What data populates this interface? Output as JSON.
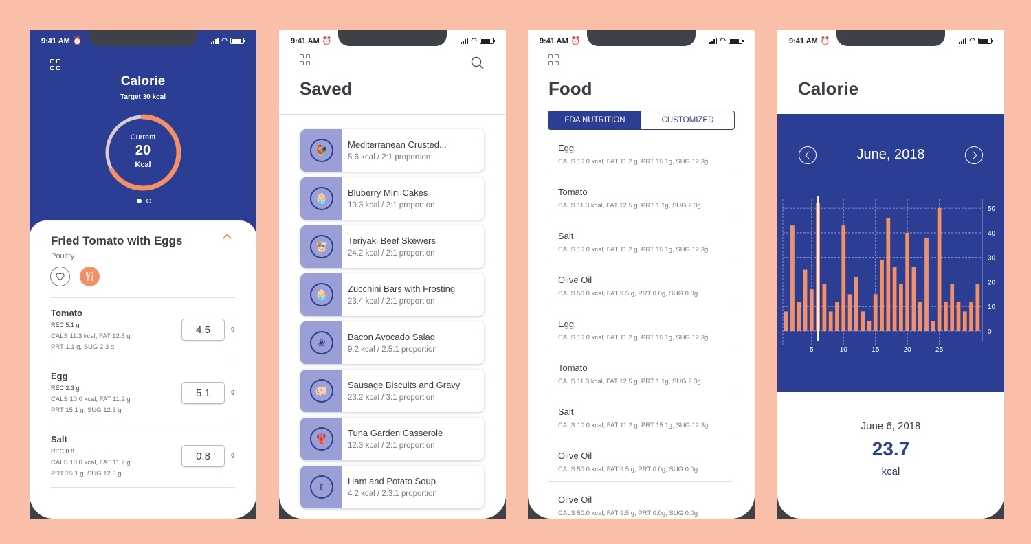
{
  "status": {
    "time": "9:41 AM"
  },
  "colors": {
    "brand": "#2c3e94",
    "accent": "#f39066",
    "background": "#f9bfa8",
    "thumb": "#9aa0d6"
  },
  "calorie_screen": {
    "title": "Calorie",
    "target": "Target 30 kcal",
    "gauge": {
      "label": "Current",
      "value": "20",
      "unit": "Kcal",
      "progress": 0.667
    },
    "recipe": {
      "title": "Fried Tomato with Eggs",
      "category": "Poultry",
      "ingredients": [
        {
          "name": "Tomato",
          "rec": "REC  5.1 g",
          "line1": "CALS 11.3 kcal, FAT 12.5 g",
          "line2": "PRT 1.1 g, SUG 2.3 g",
          "qty": "4.5",
          "unit": "g"
        },
        {
          "name": "Egg",
          "rec": "REC 2.3 g",
          "line1": "CALS 10.0 kcal, FAT 11.2 g",
          "line2": "PRT 15.1 g, SUG 12.3 g",
          "qty": "5.1",
          "unit": "g"
        },
        {
          "name": "Salt",
          "rec": "REC 0.8",
          "line1": "CALS 10.0 kcal, FAT 11.2 g",
          "line2": "PRT 15.1 g, SUG 12.3 g",
          "qty": "0.8",
          "unit": "g"
        }
      ]
    }
  },
  "saved_screen": {
    "title": "Saved",
    "items": [
      {
        "title": "Mediterranean Crusted...",
        "sub": "5.6 kcal / 2:1 proportion",
        "icon": "chicken-icon",
        "glyph": "🐓"
      },
      {
        "title": "Bluberry Mini Cakes",
        "sub": "10.3 kcal / 2:1 proportion",
        "icon": "cupcake-icon",
        "glyph": "🧁"
      },
      {
        "title": "Teriyaki Beef Skewers",
        "sub": "24.2 kcal / 2:1 proportion",
        "icon": "cow-icon",
        "glyph": "🐮"
      },
      {
        "title": "Zucchini Bars with Frosting",
        "sub": "23.4 kcal / 2:1 proportion",
        "icon": "cupcake-icon",
        "glyph": "🧁"
      },
      {
        "title": "Bacon Avocado Salad",
        "sub": "9.2 kcal / 2.5:1 proportion",
        "icon": "salad-icon",
        "glyph": "❀"
      },
      {
        "title": "Sausage Biscuits and Gravy",
        "sub": "23.2 kcal / 3:1 proportion",
        "icon": "pig-icon",
        "glyph": "🐖"
      },
      {
        "title": "Tuna Garden Casserole",
        "sub": "12.3 kcal / 2:1 proportion",
        "icon": "lobster-icon",
        "glyph": "🦞"
      },
      {
        "title": "Ham and Potato Soup",
        "sub": "4.2 kcal / 2.3:1 proportion",
        "icon": "ladle-icon",
        "glyph": "ℓ"
      }
    ]
  },
  "food_screen": {
    "title": "Food",
    "tabs": [
      "FDA NUTRITION",
      "CUSTOMIZED"
    ],
    "items": [
      {
        "name": "Egg",
        "detail": "CALS 10.0 kcal, FAT 11.2 g, PRT 15.1g, SUG 12.3g"
      },
      {
        "name": "Tomato",
        "detail": "CALS 11.3 kcal, FAT 12.5 g, PRT 1.1g, SUG 2.3g"
      },
      {
        "name": "Salt",
        "detail": "CALS 10.0 kcal, FAT 11.2 g, PRT 15.1g, SUG 12.3g"
      },
      {
        "name": "Olive Oil",
        "detail": "CALS 50.0 kcal, FAT 9.5 g, PRT 0.0g, SUG 0.0g"
      },
      {
        "name": "Egg",
        "detail": "CALS 10.0 kcal, FAT 11.2 g, PRT 15.1g, SUG 12.3g"
      },
      {
        "name": "Tomato",
        "detail": "CALS 11.3 kcal, FAT 12.5 g, PRT 1.1g, SUG 2.3g"
      },
      {
        "name": "Salt",
        "detail": "CALS 10.0 kcal, FAT 11.2 g, PRT 15.1g, SUG 12.3g"
      },
      {
        "name": "Olive Oil",
        "detail": "CALS 50.0 kcal, FAT 9.5 g, PRT 0.0g, SUG 0.0g"
      },
      {
        "name": "Olive Oil",
        "detail": "CALS 50.0 kcal, FAT 9.5 g, PRT 0.0g, SUG 0.0g"
      }
    ]
  },
  "stats_screen": {
    "title": "Calorie",
    "month": "June, 2018",
    "selected_date": "June 6, 2018",
    "selected_value": "23.7",
    "selected_unit": "kcal"
  },
  "chart_data": {
    "type": "bar",
    "x": [
      1,
      2,
      3,
      4,
      5,
      6,
      7,
      8,
      9,
      10,
      11,
      12,
      13,
      14,
      15,
      16,
      17,
      18,
      19,
      20,
      21,
      22,
      23,
      24,
      25,
      26,
      27,
      28,
      29,
      30
    ],
    "values": [
      8,
      43,
      12,
      25,
      17,
      52,
      19,
      8,
      12,
      43,
      15,
      22,
      8,
      4,
      15,
      29,
      46,
      26,
      19,
      40,
      26,
      12,
      38,
      4,
      50,
      12,
      19,
      12,
      8,
      12,
      19
    ],
    "xticks": [
      5,
      10,
      15,
      20,
      25
    ],
    "yticks": [
      0,
      10,
      20,
      30,
      40,
      50
    ],
    "ylim": [
      0,
      52
    ],
    "grid": true,
    "selected_x": 6
  }
}
